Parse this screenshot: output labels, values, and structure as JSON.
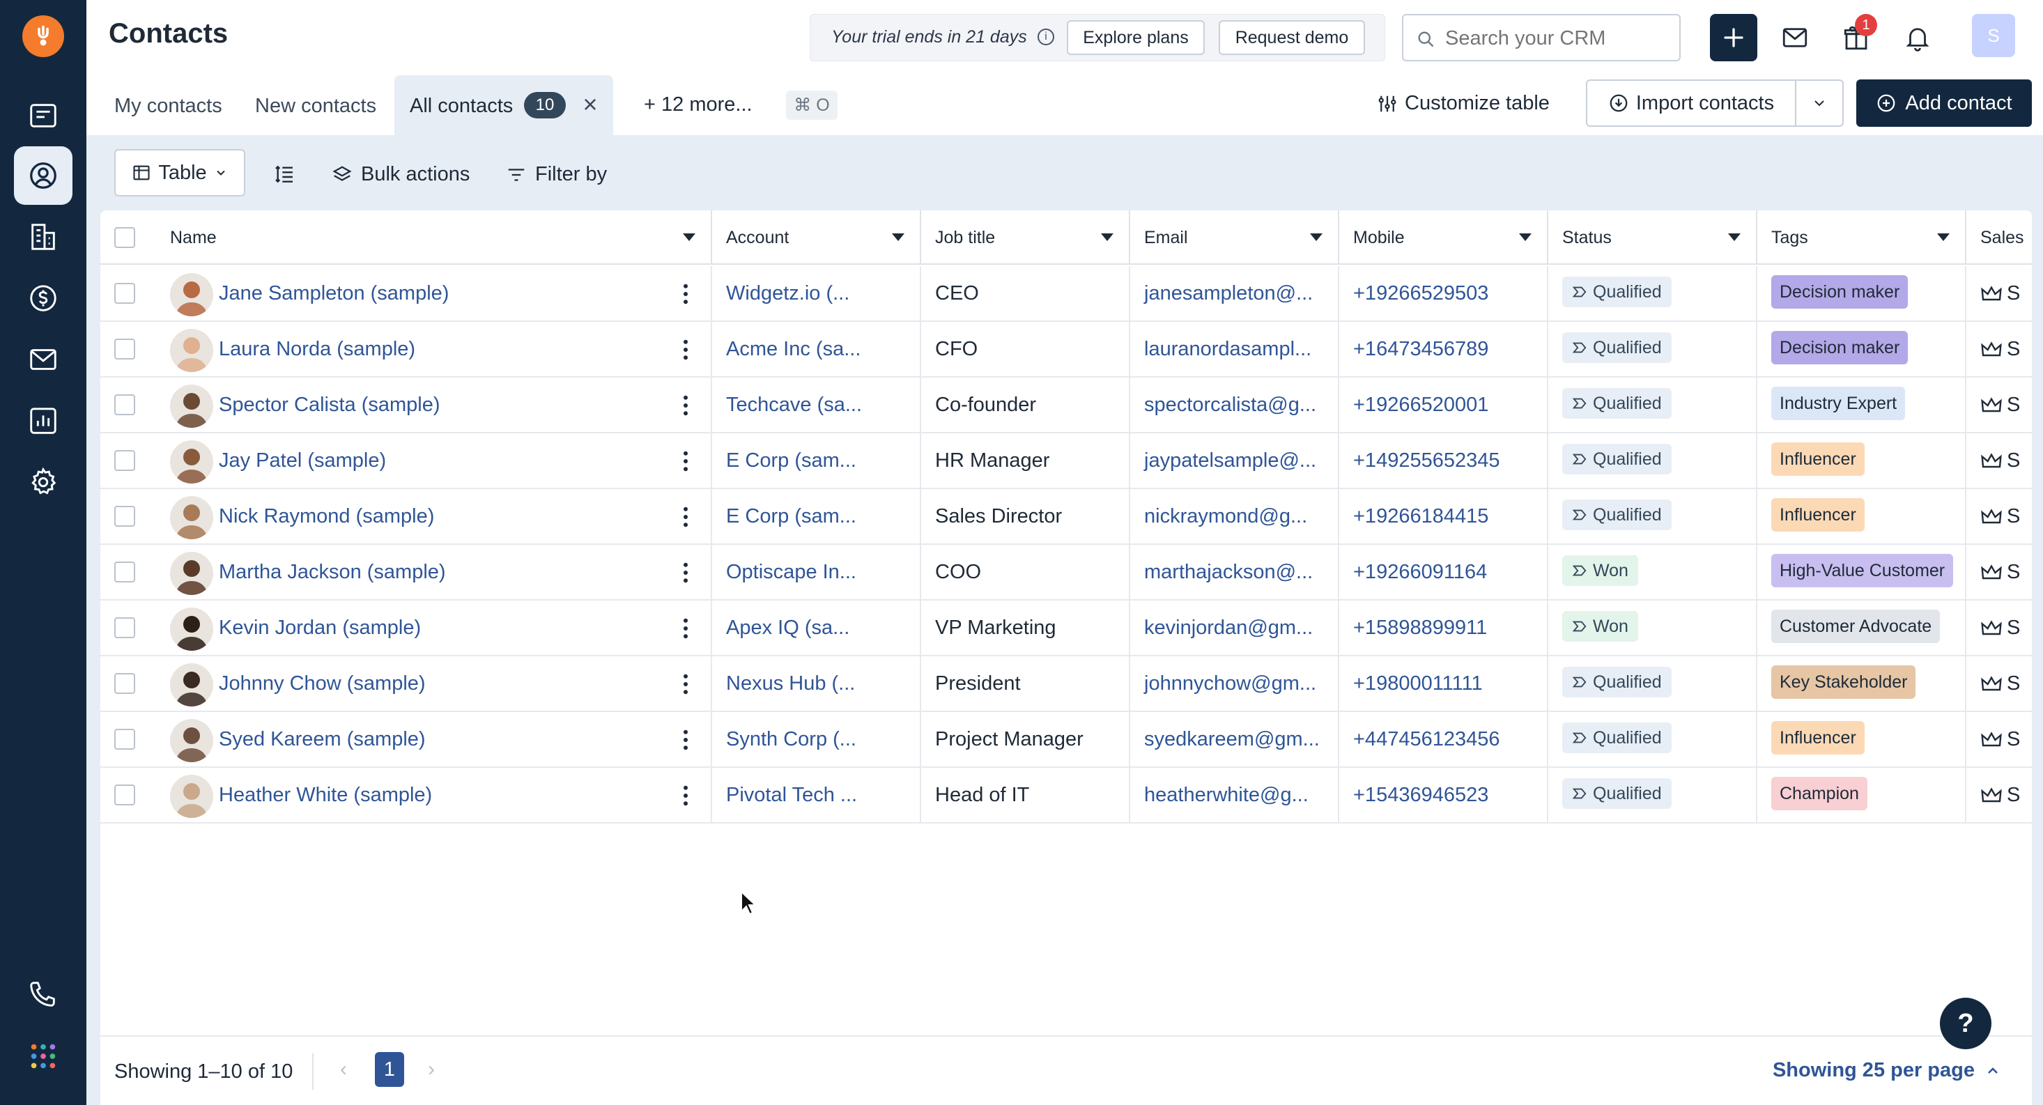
{
  "header": {
    "title": "Contacts",
    "trial_text": "Your trial ends in 21 days",
    "explore_label": "Explore plans",
    "demo_label": "Request demo",
    "search_placeholder": "Search your CRM",
    "gift_badge": "1",
    "user_initial": "S"
  },
  "tabs": {
    "my_contacts": "My contacts",
    "new_contacts": "New contacts",
    "all_contacts": "All contacts",
    "all_count": "10",
    "more": "12 more...",
    "shortcut": "⌘ O"
  },
  "actions": {
    "customize": "Customize table",
    "import": "Import contacts",
    "add": "Add contact"
  },
  "toolbar": {
    "view": "Table",
    "bulk": "Bulk actions",
    "filter": "Filter by"
  },
  "columns": [
    "Name",
    "Account",
    "Job title",
    "Email",
    "Mobile",
    "Status",
    "Tags",
    "Sales"
  ],
  "rows": [
    {
      "name": "Jane Sampleton (sample)",
      "account": "Widgetz.io (...",
      "job": "CEO",
      "email": "janesampleton@...",
      "mobile": "+19266529503",
      "status": "Qualified",
      "tag": "Decision maker",
      "sales": "S"
    },
    {
      "name": "Laura Norda (sample)",
      "account": "Acme Inc (sa...",
      "job": "CFO",
      "email": "lauranordasampl...",
      "mobile": "+16473456789",
      "status": "Qualified",
      "tag": "Decision maker",
      "sales": "S"
    },
    {
      "name": "Spector Calista (sample)",
      "account": "Techcave (sa...",
      "job": "Co-founder",
      "email": "spectorcalista@g...",
      "mobile": "+19266520001",
      "status": "Qualified",
      "tag": "Industry Expert",
      "sales": "S"
    },
    {
      "name": "Jay Patel (sample)",
      "account": "E Corp (sam...",
      "job": "HR Manager",
      "email": "jaypatelsample@...",
      "mobile": "+149255652345",
      "status": "Qualified",
      "tag": "Influencer",
      "sales": "S"
    },
    {
      "name": "Nick Raymond (sample)",
      "account": "E Corp (sam...",
      "job": "Sales Director",
      "email": "nickraymond@g...",
      "mobile": "+19266184415",
      "status": "Qualified",
      "tag": "Influencer",
      "sales": "S"
    },
    {
      "name": "Martha Jackson (sample)",
      "account": "Optiscape In...",
      "job": "COO",
      "email": "marthajackson@...",
      "mobile": "+19266091164",
      "status": "Won",
      "tag": "High-Value Customer",
      "sales": "S"
    },
    {
      "name": "Kevin Jordan (sample)",
      "account": "Apex IQ (sa...",
      "job": "VP Marketing",
      "email": "kevinjordan@gm...",
      "mobile": "+15898899911",
      "status": "Won",
      "tag": "Customer Advocate",
      "sales": "S"
    },
    {
      "name": "Johnny Chow (sample)",
      "account": "Nexus Hub (...",
      "job": "President",
      "email": "johnnychow@gm...",
      "mobile": "+19800011111",
      "status": "Qualified",
      "tag": "Key Stakeholder",
      "sales": "S"
    },
    {
      "name": "Syed Kareem (sample)",
      "account": "Synth Corp (...",
      "job": "Project Manager",
      "email": "syedkareem@gm...",
      "mobile": "+447456123456",
      "status": "Qualified",
      "tag": "Influencer",
      "sales": "S"
    },
    {
      "name": "Heather White (sample)",
      "account": "Pivotal Tech ...",
      "job": "Head of IT",
      "email": "heatherwhite@g...",
      "mobile": "+15436946523",
      "status": "Qualified",
      "tag": "Champion",
      "sales": "S"
    }
  ],
  "tag_colors": {
    "Decision maker": "#b3a8e8",
    "Industry Expert": "#dbe7f7",
    "Influencer": "#fbd9b5",
    "High-Value Customer": "#c8bff0",
    "Customer Advocate": "#e2e5e9",
    "Key Stakeholder": "#e6c6a4",
    "Champion": "#f8cfd2"
  },
  "avatar_colors": [
    "#b86a44",
    "#e0b090",
    "#6b4a34",
    "#8a5a3c",
    "#a87a58",
    "#5a3a28",
    "#2e1f18",
    "#3a2a22",
    "#6e5040",
    "#c9a98a"
  ],
  "footer": {
    "showing": "Showing 1–10 of 10",
    "page": "1",
    "per_page": "Showing 25 per page"
  },
  "help_label": "?"
}
